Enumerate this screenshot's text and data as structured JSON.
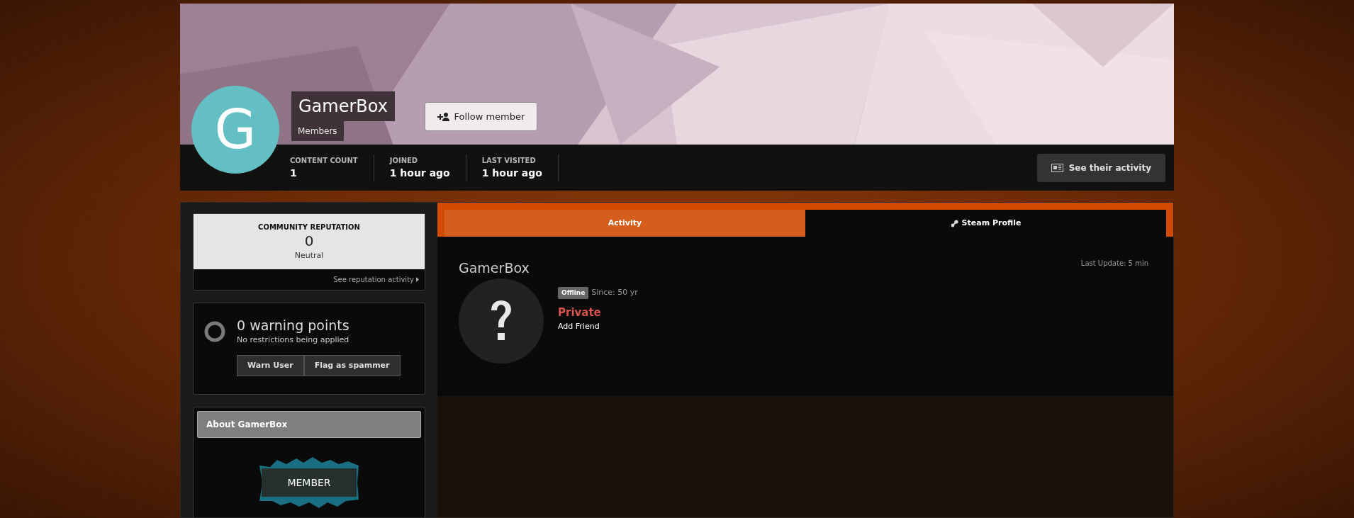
{
  "profile": {
    "initial": "G",
    "name": "GamerBox",
    "group": "Members",
    "follow_button": "Follow member",
    "activity_button": "See their activity",
    "stats": [
      {
        "label": "CONTENT COUNT",
        "value": "1"
      },
      {
        "label": "JOINED",
        "value": "1 hour ago"
      },
      {
        "label": "LAST VISITED",
        "value": "1 hour ago"
      }
    ]
  },
  "reputation": {
    "title": "COMMUNITY REPUTATION",
    "value": "0",
    "label": "Neutral",
    "link": "See reputation activity"
  },
  "warnings": {
    "title": "0 warning points",
    "subtitle": "No restrictions being applied",
    "buttons": [
      "Warn User",
      "Flag as spammer"
    ]
  },
  "about": {
    "title": "About GamerBox",
    "badge": "MEMBER"
  },
  "tabs": [
    {
      "label": "Activity",
      "selected": false
    },
    {
      "label": "Steam Profile",
      "selected": true
    }
  ],
  "steam": {
    "name": "GamerBox",
    "last_update": "Last Update: 5 min",
    "status": "Offline",
    "since": "Since: 50 yr",
    "privacy": "Private",
    "add_friend": "Add Friend"
  }
}
